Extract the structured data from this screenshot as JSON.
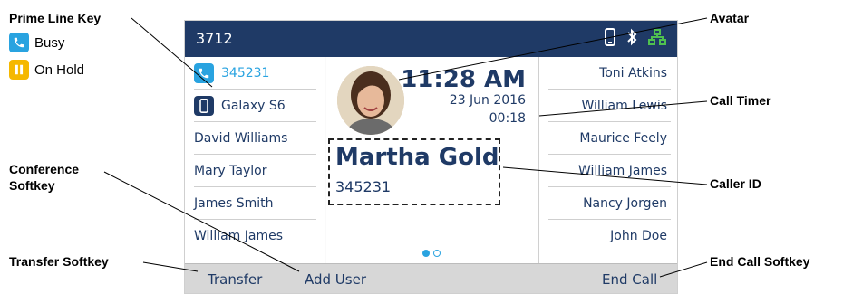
{
  "callouts": {
    "prime_line_key": "Prime Line Key",
    "conference_softkey_line1": "Conference",
    "conference_softkey_line2": "Softkey",
    "transfer_softkey": "Transfer Softkey",
    "avatar": "Avatar",
    "call_timer": "Call Timer",
    "caller_id": "Caller ID",
    "end_call_softkey": "End Call Softkey"
  },
  "legend": {
    "busy": {
      "label": "Busy",
      "icon": "phone-icon",
      "color": "#29a3e0"
    },
    "on_hold": {
      "label": "On Hold",
      "icon": "pause-icon",
      "color": "#f5b800"
    }
  },
  "phone": {
    "extension": "3712",
    "status_icons": [
      "mobile-icon",
      "bluetooth-icon",
      "network-icon"
    ],
    "left_lines": [
      {
        "label": "345231",
        "icon": "phone-icon",
        "icon_color": "#29a3e0"
      },
      {
        "label": "Galaxy S6",
        "icon": "mobile-icon",
        "icon_color": "#1f3a66"
      },
      {
        "label": "David Williams"
      },
      {
        "label": "Mary Taylor"
      },
      {
        "label": "James Smith"
      },
      {
        "label": "William James"
      }
    ],
    "right_lines": [
      {
        "label": "Toni Atkins"
      },
      {
        "label": "William Lewis"
      },
      {
        "label": "Maurice Feely"
      },
      {
        "label": "William James"
      },
      {
        "label": "Nancy Jorgen"
      },
      {
        "label": "John Doe"
      }
    ],
    "call": {
      "time": "11:28 AM",
      "date": "23 Jun 2016",
      "timer": "00:18",
      "caller_name": "Martha Gold",
      "caller_number": "345231"
    },
    "softkeys": {
      "transfer": "Transfer",
      "add_user": "Add User",
      "end_call": "End Call"
    },
    "colors": {
      "header": "#1f3a66",
      "text": "#1f3a66",
      "softkey_bar": "#d7d7d7",
      "accent": "#29a3e0"
    }
  }
}
